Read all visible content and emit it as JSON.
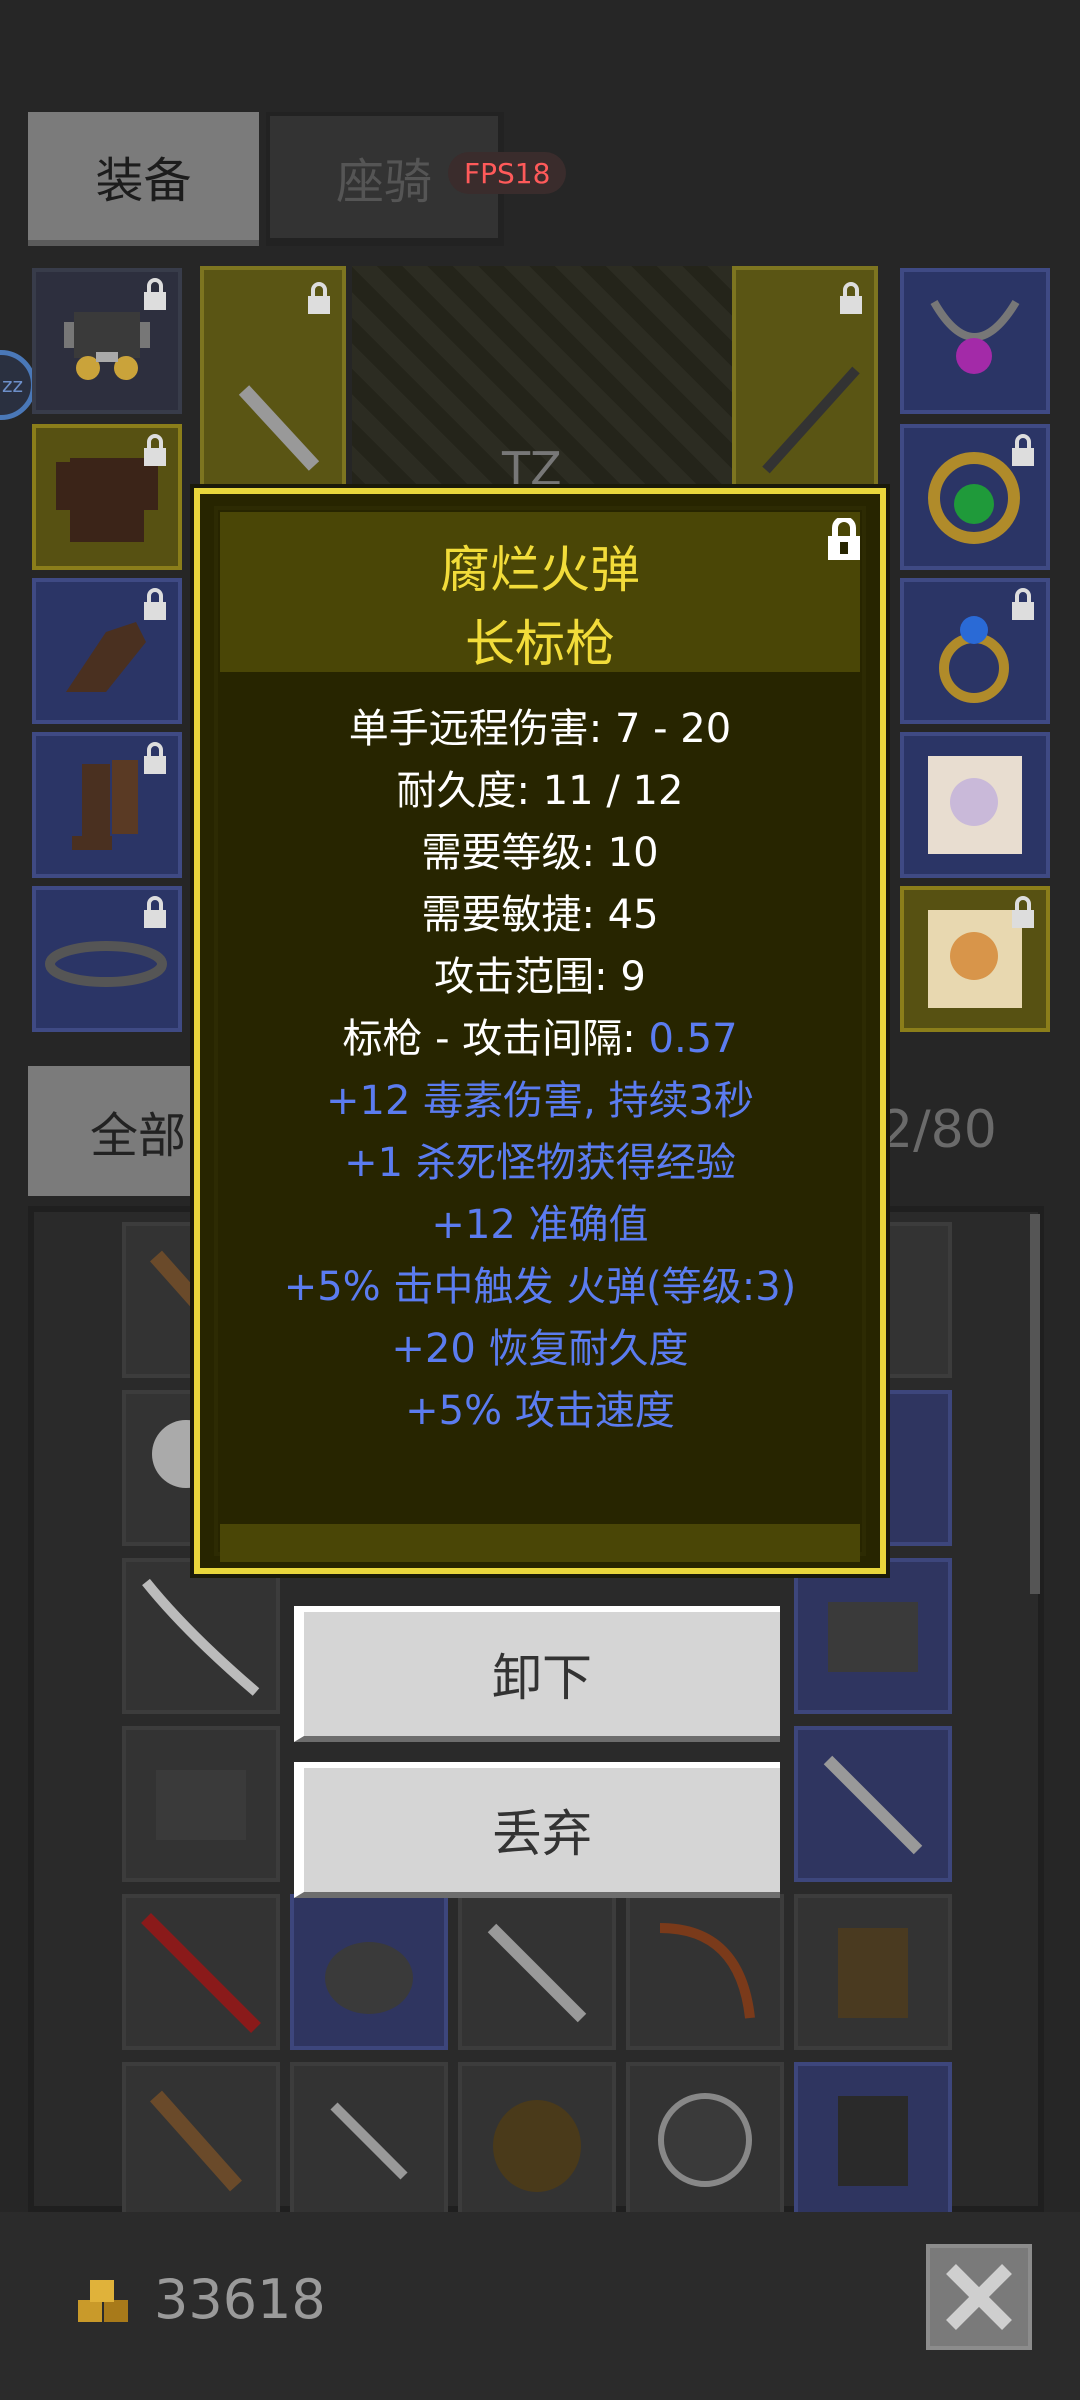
{
  "tabs": {
    "equip_label": "装备",
    "mount_label": "座骑"
  },
  "fps_badge": "FPS18",
  "status_badge": "zz",
  "character": {
    "name_partial": "TZ"
  },
  "filter": {
    "all_label": "全部",
    "count_text": "2/80"
  },
  "tooltip": {
    "item_name": "腐烂火弹",
    "item_type": "长标枪",
    "stats": [
      "单手远程伤害: 7 - 20",
      "耐久度: 11 / 12",
      "需要等级: 10",
      "需要敏捷: 45",
      "攻击范围: 9"
    ],
    "speed_prefix": "标枪 - 攻击间隔: ",
    "speed_value": "0.57",
    "affixes": [
      "+12 毒素伤害, 持续3秒",
      "+1 杀死怪物获得经验",
      "+12 准确值",
      "+5% 击中触发 火弹(等级:3)",
      "+20 恢复耐久度",
      "+5% 攻击速度"
    ]
  },
  "actions": {
    "unequip_label": "卸下",
    "discard_label": "丢弃"
  },
  "footer": {
    "gold_amount": "33618"
  },
  "colors": {
    "title_gold": "#f2dc3a",
    "affix_blue": "#5b7cf0",
    "tooltip_border": "#e9d73c"
  }
}
